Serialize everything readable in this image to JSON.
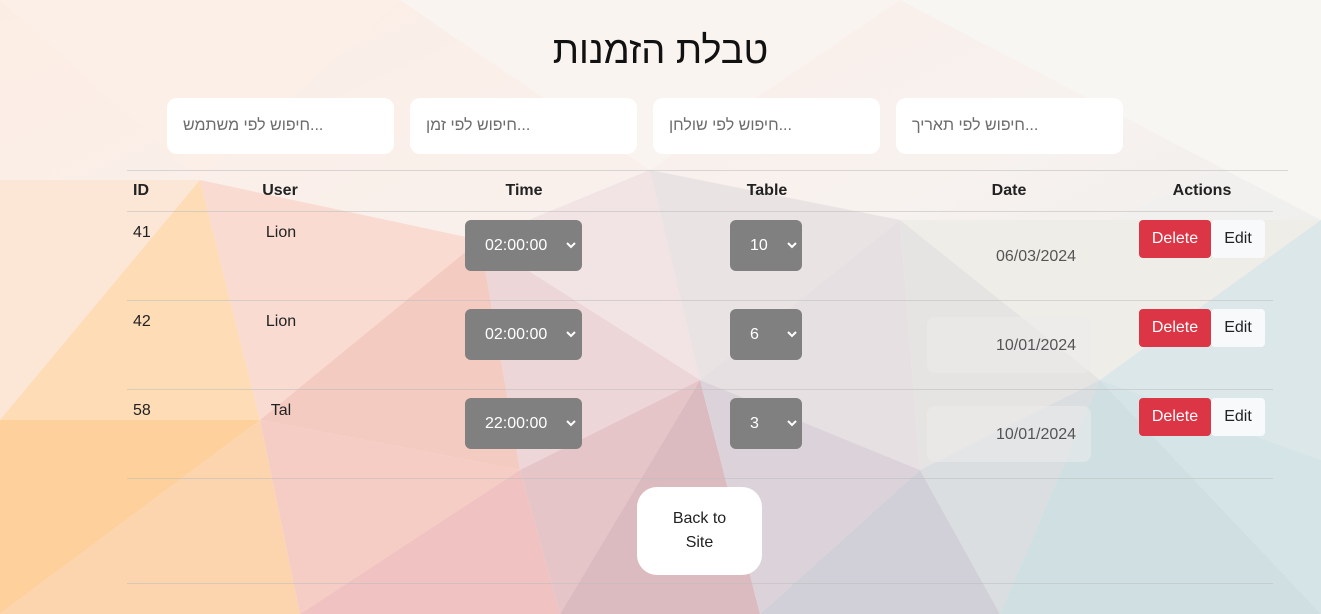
{
  "page": {
    "title": "טבלת הזמנות"
  },
  "search": {
    "user_placeholder": "חיפוש לפי משתמש...",
    "time_placeholder": "חיפוש לפי זמן...",
    "table_placeholder": "חיפוש לפי שולחן...",
    "date_placeholder": "חיפוש לפי תאריך..."
  },
  "table": {
    "headers": {
      "id": "ID",
      "user": "User",
      "time": "Time",
      "table": "Table",
      "date": "Date",
      "actions": "Actions"
    },
    "rows": [
      {
        "id": "41",
        "user": "Lion",
        "time": "02:00:00",
        "table": "10",
        "date": "06/03/2024",
        "delete_label": "Delete",
        "edit_label": "Edit"
      },
      {
        "id": "42",
        "user": "Lion",
        "time": "02:00:00",
        "table": "6",
        "date": "10/01/2024",
        "delete_label": "Delete",
        "edit_label": "Edit"
      },
      {
        "id": "58",
        "user": "Tal",
        "time": "22:00:00",
        "table": "3",
        "date": "10/01/2024",
        "delete_label": "Delete",
        "edit_label": "Edit"
      }
    ]
  },
  "footer": {
    "back_label": "Back to Site"
  },
  "colors": {
    "delete": "#dc3545",
    "select_bg": "#808080",
    "edit_bg": "#f8f9fa"
  }
}
